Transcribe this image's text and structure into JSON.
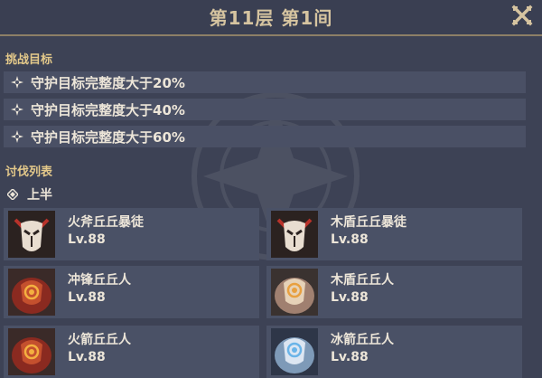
{
  "header": {
    "title": "第11层 第1间"
  },
  "objectives": {
    "heading": "挑战目标",
    "items": [
      "守护目标完整度大于20%",
      "守护目标完整度大于40%",
      "守护目标完整度大于60%"
    ]
  },
  "enemies": {
    "heading": "讨伐列表",
    "half_label": "上半",
    "list": [
      {
        "name": "火斧丘丘暴徒",
        "level": "Lv.88",
        "icon": "mitachurl-mask-icon"
      },
      {
        "name": "木盾丘丘暴徒",
        "level": "Lv.88",
        "icon": "mitachurl-mask-icon"
      },
      {
        "name": "冲锋丘丘人",
        "level": "Lv.88",
        "icon": "pyro-hilichurl-icon"
      },
      {
        "name": "木盾丘丘人",
        "level": "Lv.88",
        "icon": "wooden-hilichurl-icon"
      },
      {
        "name": "火箭丘丘人",
        "level": "Lv.88",
        "icon": "pyro-archer-hilichurl-icon"
      },
      {
        "name": "冰箭丘丘人",
        "level": "Lv.88",
        "icon": "cryo-archer-hilichurl-icon"
      }
    ]
  },
  "colors": {
    "background": "#3d4255",
    "row_bg": "#4a5065",
    "gold_heading": "#e4c98a",
    "title_gold": "#d6c4a0"
  }
}
